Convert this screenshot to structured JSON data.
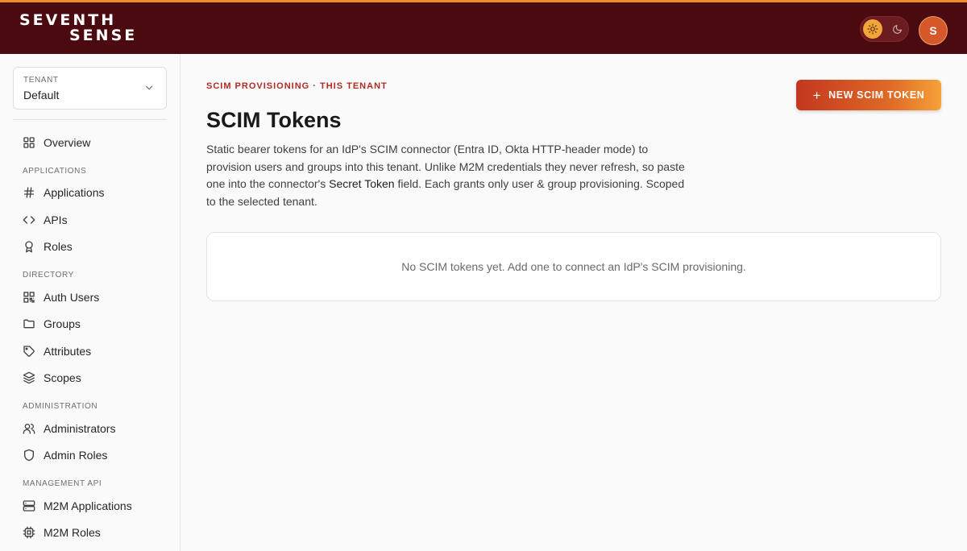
{
  "header": {
    "logo_line1": "SEVENTH",
    "logo_line2": "SENSE",
    "avatar_initial": "S"
  },
  "sidebar": {
    "tenant_label": "TENANT",
    "tenant_value": "Default",
    "overview": "Overview",
    "sections": {
      "applications": "APPLICATIONS",
      "directory": "DIRECTORY",
      "administration": "ADMINISTRATION",
      "management_api": "MANAGEMENT API"
    },
    "items": {
      "applications": "Applications",
      "apis": "APIs",
      "roles": "Roles",
      "auth_users": "Auth Users",
      "groups": "Groups",
      "attributes": "Attributes",
      "scopes": "Scopes",
      "administrators": "Administrators",
      "admin_roles": "Admin Roles",
      "m2m_applications": "M2M Applications",
      "m2m_roles": "M2M Roles"
    }
  },
  "main": {
    "eyebrow": "SCIM PROVISIONING · THIS TENANT",
    "title": "SCIM Tokens",
    "description_part1": "Static bearer tokens for an IdP's SCIM connector (Entra ID, Okta HTTP-header mode) to provision users and groups into this tenant. Unlike M2M credentials they never refresh, so paste one into the connector's ",
    "description_emphasis": "Secret Token",
    "description_part2": " field. Each grants only user & group provisioning. Scoped to the selected tenant.",
    "new_button_label": "NEW SCIM TOKEN",
    "empty_message": "No SCIM tokens yet. Add one to connect an IdP's SCIM provisioning."
  },
  "colors": {
    "header_bg": "#4a0a10",
    "accent_orange": "#f08a24",
    "eyebrow_red": "#b02a24",
    "button_gradient_start": "#c2371f",
    "button_gradient_end": "#f5a238"
  },
  "icons": {
    "overview": "grid-icon",
    "applications": "hash-icon",
    "apis": "code-icon",
    "roles": "award-icon",
    "auth_users": "qr-code-icon",
    "groups": "folder-icon",
    "attributes": "tag-icon",
    "scopes": "layers-icon",
    "administrators": "users-icon",
    "admin_roles": "shield-icon",
    "m2m_applications": "server-icon",
    "m2m_roles": "cpu-icon"
  }
}
